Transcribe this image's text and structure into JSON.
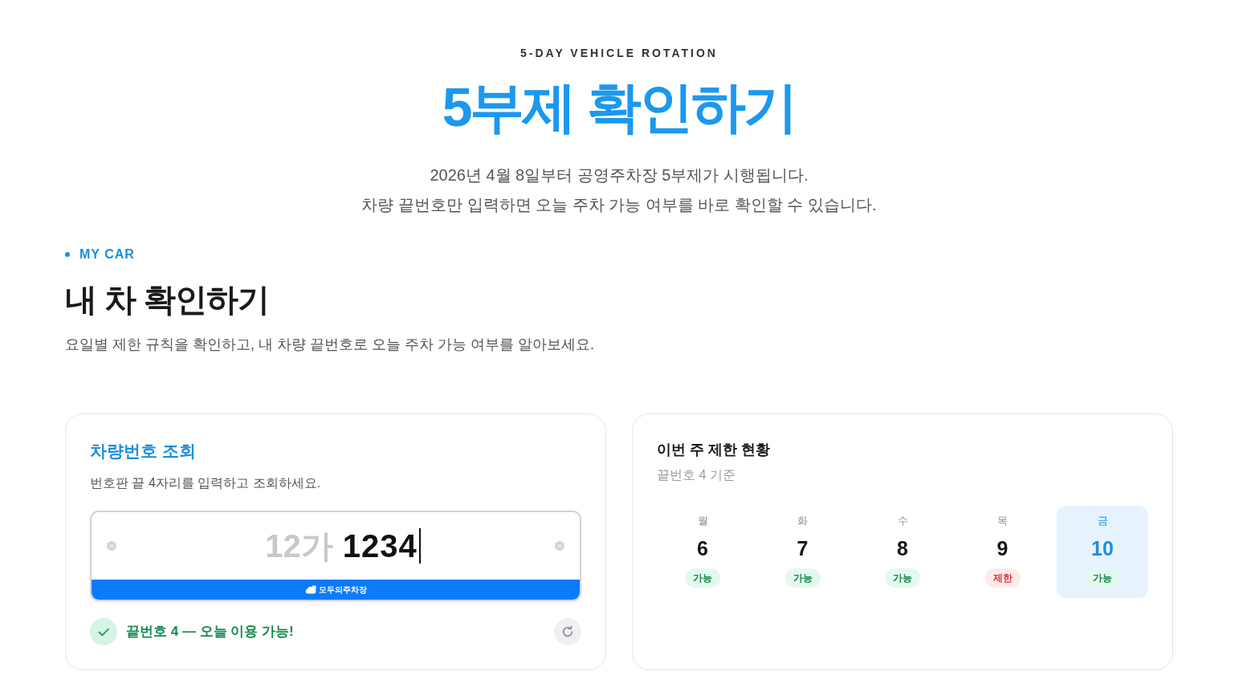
{
  "hero": {
    "eyebrow": "5-DAY VEHICLE ROTATION",
    "title": "5부제 확인하기",
    "lines": [
      "2026년 4월 8일부터 공영주차장 5부제가 시행됩니다.",
      "차량 끝번호만 입력하면 오늘 주차 가능 여부를 바로 확인할 수 있습니다."
    ]
  },
  "section": {
    "eyebrow": "MY CAR",
    "title": "내 차 확인하기",
    "description": "요일별 제한 규칙을 확인하고, 내 차량 끝번호로 오늘 주차 가능 여부를 알아보세요."
  },
  "lookup_card": {
    "title": "차량번호 조회",
    "description": "번호판 끝 4자리를 입력하고 조회하세요.",
    "plate": {
      "prefix": "12가",
      "value": "1234",
      "brand": "모두의주차장"
    },
    "result": {
      "available": true,
      "text": "끝번호 4 — 오늘 이용 가능!"
    }
  },
  "week_card": {
    "title": "이번 주 제한 현황",
    "subtitle": "끝번호 4 기준",
    "days": [
      {
        "day": "월",
        "date": "6",
        "status": "가능",
        "restricted": false,
        "selected": false
      },
      {
        "day": "화",
        "date": "7",
        "status": "가능",
        "restricted": false,
        "selected": false
      },
      {
        "day": "수",
        "date": "8",
        "status": "가능",
        "restricted": false,
        "selected": false
      },
      {
        "day": "목",
        "date": "9",
        "status": "제한",
        "restricted": true,
        "selected": false
      },
      {
        "day": "금",
        "date": "10",
        "status": "가능",
        "restricted": false,
        "selected": true
      }
    ]
  }
}
